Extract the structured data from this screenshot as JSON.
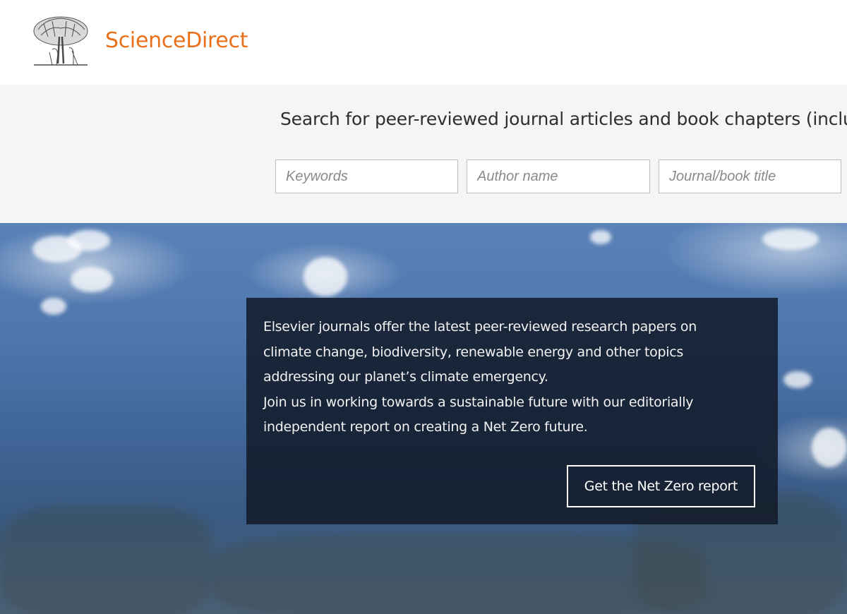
{
  "header": {
    "brand_name": "ScienceDirect",
    "brand_color": "#e9711c",
    "logo_icon": "elsevier-tree-logo"
  },
  "search": {
    "heading": "Search for peer-reviewed journal articles and book chapters (includ",
    "keywords_placeholder": "Keywords",
    "author_placeholder": "Author name",
    "journal_placeholder": "Journal/book title"
  },
  "hero": {
    "lines": [
      "Elsevier journals offer the latest peer-reviewed research papers on",
      "climate change, biodiversity, renewable energy and other topics",
      "addressing our planet’s climate emergency.",
      "Join us in working towards a sustainable future with our editorially",
      "independent report on creating a Net Zero future."
    ],
    "cta_label": "Get the Net Zero report"
  }
}
